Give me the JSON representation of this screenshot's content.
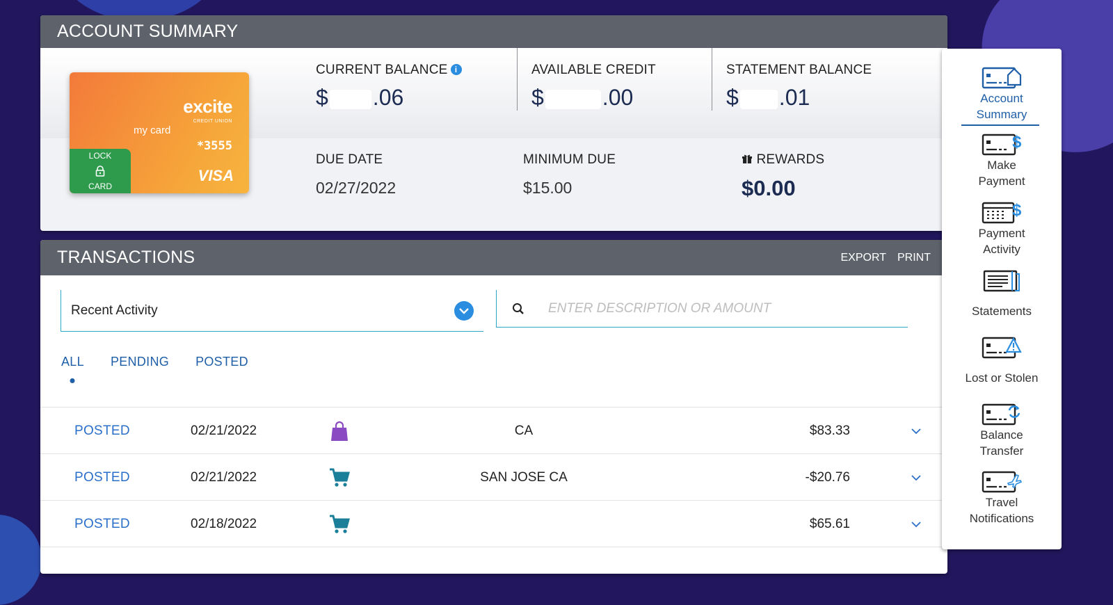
{
  "summary": {
    "title": "ACCOUNT SUMMARY",
    "card": {
      "brand": "excite",
      "brand_sub": "CREDIT UNION",
      "name": "my card",
      "number": "*3555",
      "network": "VISA",
      "lock_top": "LOCK",
      "lock_bottom": "CARD"
    },
    "current_balance": {
      "label": "CURRENT BALANCE",
      "prefix": "$",
      "suffix": ".06"
    },
    "available_credit": {
      "label": "AVAILABLE CREDIT",
      "prefix": "$",
      "suffix": ".00"
    },
    "statement_balance": {
      "label": "STATEMENT BALANCE",
      "prefix": "$",
      "suffix": ".01"
    },
    "due_date": {
      "label": "DUE DATE",
      "value": "02/27/2022"
    },
    "minimum_due": {
      "label": "MINIMUM DUE",
      "value": "$15.00"
    },
    "rewards": {
      "label": "REWARDS",
      "value": "$0.00"
    }
  },
  "transactions": {
    "title": "TRANSACTIONS",
    "export_label": "EXPORT",
    "print_label": "PRINT",
    "filter_select": "Recent Activity",
    "search_placeholder": "ENTER DESCRIPTION OR AMOUNT",
    "tabs": [
      "ALL",
      "PENDING",
      "POSTED"
    ],
    "rows": [
      {
        "status": "POSTED",
        "date": "02/21/2022",
        "icon": "shopping-bag-icon",
        "description": "CA",
        "amount": "$83.33"
      },
      {
        "status": "POSTED",
        "date": "02/21/2022",
        "icon": "shopping-cart-icon",
        "description": "SAN JOSE CA",
        "amount": "-$20.76"
      },
      {
        "status": "POSTED",
        "date": "02/18/2022",
        "icon": "shopping-cart-icon",
        "description": "",
        "amount": "$65.61"
      }
    ]
  },
  "sidenav": {
    "items": [
      {
        "label": "Account\nSummary",
        "icon": "card-home-icon"
      },
      {
        "label": "Make\nPayment",
        "icon": "card-dollar-icon"
      },
      {
        "label": "Payment\nActivity",
        "icon": "calendar-dollar-icon"
      },
      {
        "label": "Statements",
        "icon": "statements-icon"
      },
      {
        "label": "Lost or Stolen",
        "icon": "card-warning-icon"
      },
      {
        "label": "Balance\nTransfer",
        "icon": "card-refresh-icon"
      },
      {
        "label": "Travel\nNotifications",
        "icon": "card-plane-icon"
      }
    ]
  },
  "colors": {
    "accent": "#1f5fa8",
    "status_blue": "#2a6fc9",
    "header_gray": "#5d626b",
    "background": "#22175e",
    "lock_green": "#2e9a4c",
    "bag_purple": "#8a4bc2",
    "cart_teal": "#1b7f99"
  }
}
